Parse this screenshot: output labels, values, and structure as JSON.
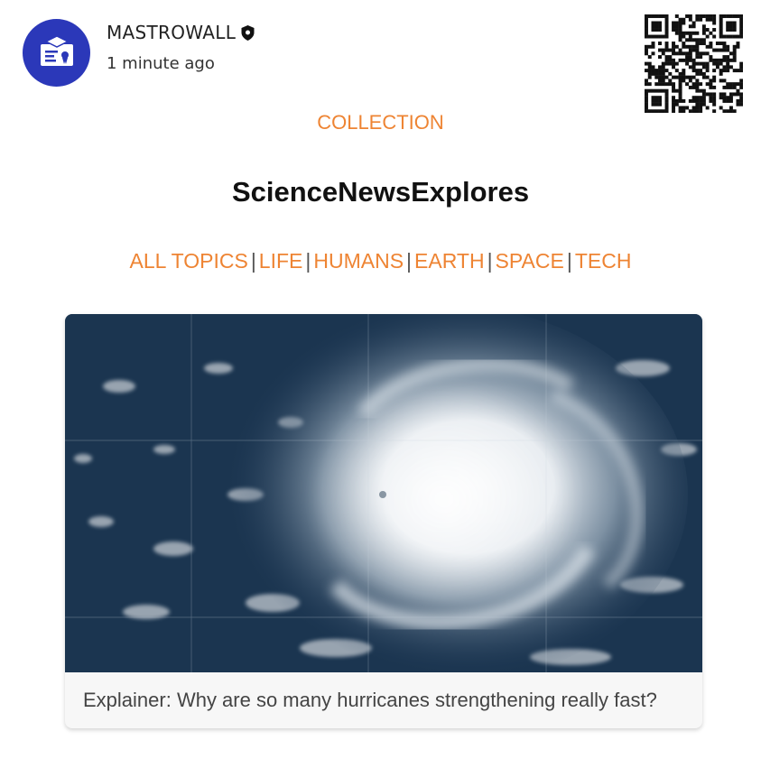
{
  "post": {
    "author": "MASTROWALL",
    "timestamp": "1 minute ago",
    "avatar_icon": "school-certificate-icon",
    "verified_icon": "verified-shield-icon",
    "avatar_color": "#2b38b9"
  },
  "qr_icon": "qr-code",
  "collection_label": "COLLECTION",
  "site_title": "ScienceNewsExplores",
  "topics": [
    "ALL TOPICS",
    "LIFE",
    "HUMANS",
    "EARTH",
    "SPACE",
    "TECH"
  ],
  "topic_separator": "|",
  "accent_color": "#ee8433",
  "card": {
    "image_icon": "hurricane-satellite-image",
    "caption": "Explainer: Why are so many hurricanes strengthening really fast?"
  }
}
